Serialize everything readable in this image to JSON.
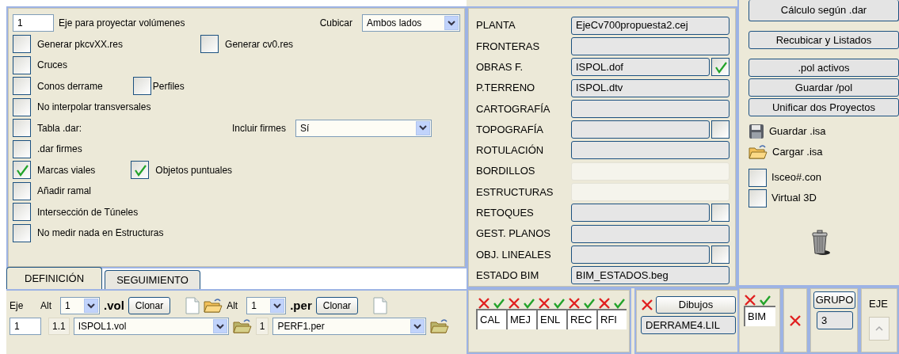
{
  "options": {
    "axis_value": "1",
    "axis_label": "Eje para proyectar volúmenes",
    "cubicar": {
      "label": "Cubicar",
      "value": "Ambos lados"
    },
    "rows": [
      {
        "items": [
          {
            "kind": "checkbox",
            "label": "Generar pkcvXX.res",
            "checked": false
          },
          {
            "kind": "checkbox",
            "label": "Generar cv0.res",
            "checked": false
          }
        ]
      },
      {
        "items": [
          {
            "kind": "checkbox",
            "label": "Cruces",
            "checked": false
          }
        ]
      },
      {
        "items": [
          {
            "kind": "checkbox",
            "label": "Conos derrame",
            "checked": false
          },
          {
            "kind": "checkbox",
            "label": "Perfiles",
            "checked": false
          }
        ]
      },
      {
        "items": [
          {
            "kind": "checkbox",
            "label": "No interpolar transversales",
            "checked": false
          }
        ]
      },
      {
        "items": [
          {
            "kind": "checkbox",
            "label": "Tabla .dar:",
            "checked": false
          },
          {
            "kind": "select",
            "label": "Incluir firmes",
            "value": "Sí"
          }
        ]
      },
      {
        "items": [
          {
            "kind": "checkbox",
            "label": ".dar firmes",
            "checked": false
          }
        ]
      },
      {
        "items": [
          {
            "kind": "checkbox",
            "label": "Marcas viales",
            "checked": true
          },
          {
            "kind": "checkbox",
            "label": "Objetos puntuales",
            "checked": true
          }
        ]
      },
      {
        "items": [
          {
            "kind": "checkbox",
            "label": "Añadir ramal",
            "checked": false
          }
        ]
      },
      {
        "items": [
          {
            "kind": "checkbox",
            "label": "Intersección de Túneles",
            "checked": false
          }
        ]
      },
      {
        "items": [
          {
            "kind": "checkbox",
            "label": "No medir nada en Estructuras",
            "checked": false
          }
        ]
      }
    ]
  },
  "tabs": [
    {
      "label": "DEFINICIÓN",
      "selected": true
    },
    {
      "label": "SEGUIMIENTO",
      "selected": false
    }
  ],
  "definition": {
    "eje_label": "Eje",
    "eje_value": "1",
    "groups": [
      {
        "alt_label": "Alt",
        "alt_value": "1",
        "ext": ".vol",
        "clone_button": "Clonar",
        "index": "1.1",
        "file": "ISPOL1.vol",
        "open_icon": true
      },
      {
        "alt_label": "Alt",
        "alt_value": "1",
        "ext": ".per",
        "clone_button": "Clonar",
        "index": "1",
        "file": "PERF1.per",
        "open_icon": false
      }
    ]
  },
  "files": [
    {
      "label": "PLANTA",
      "value": "EjeCv700propuesta2.cej",
      "disabled": false,
      "kind": "plain"
    },
    {
      "label": "FRONTERAS",
      "disabled": false,
      "kind": "plain"
    },
    {
      "label": "OBRAS F.",
      "value": "ISPOL.dof",
      "disabled": false,
      "kind": "checkbox",
      "checked": true
    },
    {
      "label": "P.TERRENO",
      "value": "ISPOL.dtv",
      "disabled": false,
      "kind": "plain"
    },
    {
      "label": "CARTOGRAFÍA",
      "disabled": false,
      "kind": "plain"
    },
    {
      "label": "TOPOGRAFÍA",
      "disabled": false,
      "kind": "checkbox",
      "checked": false
    },
    {
      "label": "ROTULACIÓN",
      "disabled": false,
      "kind": "plain"
    },
    {
      "label": "BORDILLOS",
      "disabled": true,
      "kind": "plain"
    },
    {
      "label": "ESTRUCTURAS",
      "disabled": true,
      "kind": "plain"
    },
    {
      "label": "RETOQUES",
      "disabled": false,
      "kind": "checkbox",
      "checked": false
    },
    {
      "label": "GEST. PLANOS",
      "disabled": false,
      "kind": "plain"
    },
    {
      "label": "OBJ. LINEALES",
      "disabled": false,
      "kind": "checkbox",
      "checked": false
    },
    {
      "label": "ESTADO BIM",
      "value": "BIM_ESTADOS.beg",
      "disabled": false,
      "kind": "plain"
    }
  ],
  "modules": [
    {
      "label": "CAL",
      "marks": [
        {
          "ok": false
        },
        {
          "ok": true
        }
      ]
    },
    {
      "label": "MEJ",
      "marks": [
        {
          "ok": false
        },
        {
          "ok": true
        }
      ]
    },
    {
      "label": "ENL",
      "marks": [
        {
          "ok": false
        },
        {
          "ok": true
        }
      ]
    },
    {
      "label": "REC",
      "marks": [
        {
          "ok": false
        },
        {
          "ok": true
        }
      ]
    },
    {
      "label": "RFI",
      "marks": [
        {
          "ok": false
        },
        {
          "ok": true
        }
      ]
    }
  ],
  "drawings": {
    "mark": {
      "ok": false
    },
    "button": "Dibujos",
    "file": "DERRAME4.LIL"
  },
  "action_groups": [
    [
      "Cálculo según .dar"
    ],
    [
      "Recubicar y Listados"
    ],
    [
      ".pol activos",
      "Guardar /pol",
      "Unificar dos Proyectos"
    ]
  ],
  "isa_links": [
    {
      "kind": "save",
      "label": "Guardar .isa"
    },
    {
      "kind": "load",
      "label": "Cargar  .isa"
    }
  ],
  "extra_checks": [
    {
      "label": "Isceo#.con",
      "checked": false
    },
    {
      "label": "Virtual 3D",
      "checked": false
    }
  ],
  "bim": {
    "marks": [
      {
        "ok": false
      },
      {
        "ok": true
      }
    ],
    "value": "BIM"
  },
  "solo_mark": {
    "ok": false
  },
  "grupo": {
    "button": "GRUPO",
    "value": "3"
  },
  "eje": {
    "label": "EJE"
  }
}
